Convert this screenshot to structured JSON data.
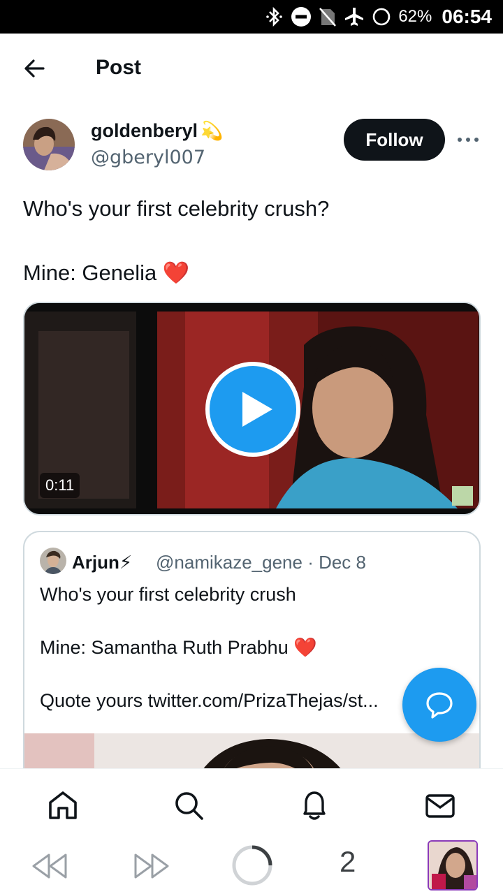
{
  "status_bar": {
    "battery": "62%",
    "time": "06:54",
    "icons": [
      "bluetooth-icon",
      "do-not-disturb-icon",
      "no-sim-icon",
      "airplane-icon",
      "battery-icon"
    ]
  },
  "header": {
    "title": "Post",
    "back_icon": "arrow-left-icon"
  },
  "post": {
    "author_name": "goldenberyl",
    "author_badge": "💫",
    "author_handle": "@gberyl007",
    "follow_label": "Follow",
    "text": "Who's your first celebrity crush?\n\nMine: Genelia ❤️",
    "video": {
      "duration": "0:11"
    }
  },
  "quote": {
    "name": "Arjun⚡",
    "handle_date": "@namikaze_gene · Dec 8",
    "text": "Who's your first celebrity crush\n\nMine: Samantha Ruth Prabhu ❤️\n\nQuote yours  twitter.com/PrizaThejas/st..."
  },
  "bottom_nav": [
    "home-icon",
    "search-icon",
    "notifications-icon",
    "messages-icon"
  ],
  "browser_bar": {
    "tab_count": "2"
  },
  "colors": {
    "accent": "#1d9bf0",
    "text": "#0f1419",
    "secondary": "#536471"
  }
}
